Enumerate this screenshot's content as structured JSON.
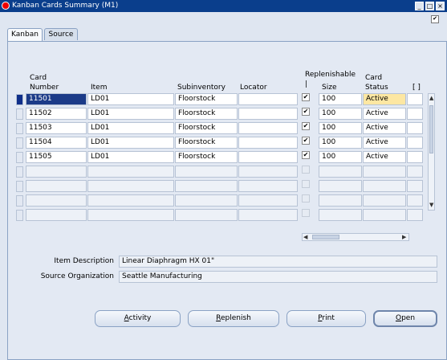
{
  "window": {
    "title": "Kanban Cards Summary (M1)"
  },
  "tabs": [
    {
      "label": "Kanban",
      "active": true
    },
    {
      "label": "Source",
      "active": false
    }
  ],
  "columns": {
    "card_number": "Card\nNumber",
    "item": "Item",
    "subinventory": "Subinventory",
    "locator": "Locator",
    "replenishable": "Replenishable\n|",
    "size": "Size",
    "card_status": "Card\nStatus",
    "extra": "[ ]"
  },
  "rows": [
    {
      "card_number": "11501",
      "item": "LD01",
      "subinventory": "Floorstock",
      "locator": "",
      "replenishable": true,
      "size": "100",
      "status": "Active",
      "current": true
    },
    {
      "card_number": "11502",
      "item": "LD01",
      "subinventory": "Floorstock",
      "locator": "",
      "replenishable": true,
      "size": "100",
      "status": "Active",
      "current": false
    },
    {
      "card_number": "11503",
      "item": "LD01",
      "subinventory": "Floorstock",
      "locator": "",
      "replenishable": true,
      "size": "100",
      "status": "Active",
      "current": false
    },
    {
      "card_number": "11504",
      "item": "LD01",
      "subinventory": "Floorstock",
      "locator": "",
      "replenishable": true,
      "size": "100",
      "status": "Active",
      "current": false
    },
    {
      "card_number": "11505",
      "item": "LD01",
      "subinventory": "Floorstock",
      "locator": "",
      "replenishable": true,
      "size": "100",
      "status": "Active",
      "current": false
    },
    {
      "card_number": "",
      "item": "",
      "subinventory": "",
      "locator": "",
      "replenishable": false,
      "size": "",
      "status": "",
      "current": false
    },
    {
      "card_number": "",
      "item": "",
      "subinventory": "",
      "locator": "",
      "replenishable": false,
      "size": "",
      "status": "",
      "current": false
    },
    {
      "card_number": "",
      "item": "",
      "subinventory": "",
      "locator": "",
      "replenishable": false,
      "size": "",
      "status": "",
      "current": false
    },
    {
      "card_number": "",
      "item": "",
      "subinventory": "",
      "locator": "",
      "replenishable": false,
      "size": "",
      "status": "",
      "current": false
    }
  ],
  "details": {
    "item_description_label": "Item Description",
    "item_description": "Linear Diaphragm HX 01\"",
    "source_org_label": "Source Organization",
    "source_org": "Seattle Manufacturing"
  },
  "buttons": {
    "activity_pre": "",
    "activity_key": "A",
    "activity_post": "ctivity",
    "replenish_pre": "",
    "replenish_key": "R",
    "replenish_post": "eplenish",
    "print_pre": "",
    "print_key": "P",
    "print_post": "rint",
    "open_pre": "",
    "open_key": "O",
    "open_post": "pen"
  },
  "colors": {
    "titlebar": "#0a3e8c",
    "background": "#dfe6f1",
    "current_record": "#102f8a",
    "current_field": "#fde7a2"
  },
  "icons": {
    "window_app": "oracle-icon",
    "minimize": "minimize-icon",
    "maximize": "maximize-icon",
    "close": "close-icon",
    "checkbox_checked": "check-icon"
  }
}
